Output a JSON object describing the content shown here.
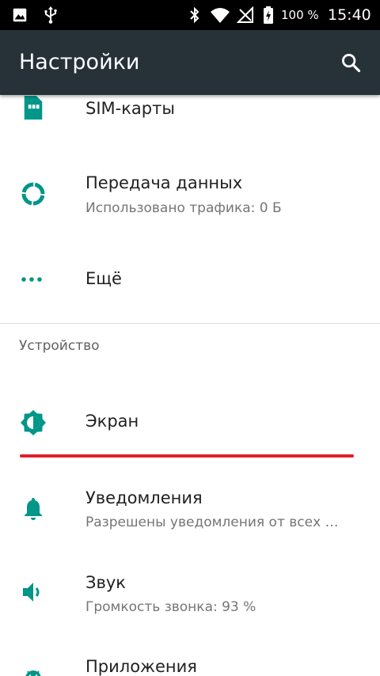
{
  "status_bar": {
    "battery_percent": "100 %",
    "time": "15:40",
    "icons": [
      "image-icon",
      "usb-icon",
      "bluetooth-icon",
      "wifi-icon",
      "no-signal-icon",
      "battery-charging-icon"
    ]
  },
  "app_bar": {
    "title": "Настройки",
    "search_icon": "search-icon"
  },
  "settings": {
    "sim": {
      "title": "SIM-карты",
      "icon": "sim-card-icon"
    },
    "data_usage": {
      "title": "Передача данных",
      "subtitle": "Использовано трафика: 0 Б",
      "icon": "data-usage-icon"
    },
    "more": {
      "title": "Ещё",
      "icon": "more-horiz-icon"
    },
    "device_section": {
      "header": "Устройство"
    },
    "display": {
      "title": "Экран",
      "icon": "brightness-icon"
    },
    "notifications": {
      "title": "Уведомления",
      "subtitle": "Разрешены уведомления от всех …",
      "icon": "bell-icon"
    },
    "sound": {
      "title": "Звук",
      "subtitle": "Громкость звонка: 93 %",
      "icon": "volume-icon"
    },
    "apps": {
      "title": "Приложения",
      "icon": "android-icon"
    }
  },
  "colors": {
    "accent": "#009688",
    "appbar": "#263238",
    "highlight_line": "#e01e2c"
  }
}
